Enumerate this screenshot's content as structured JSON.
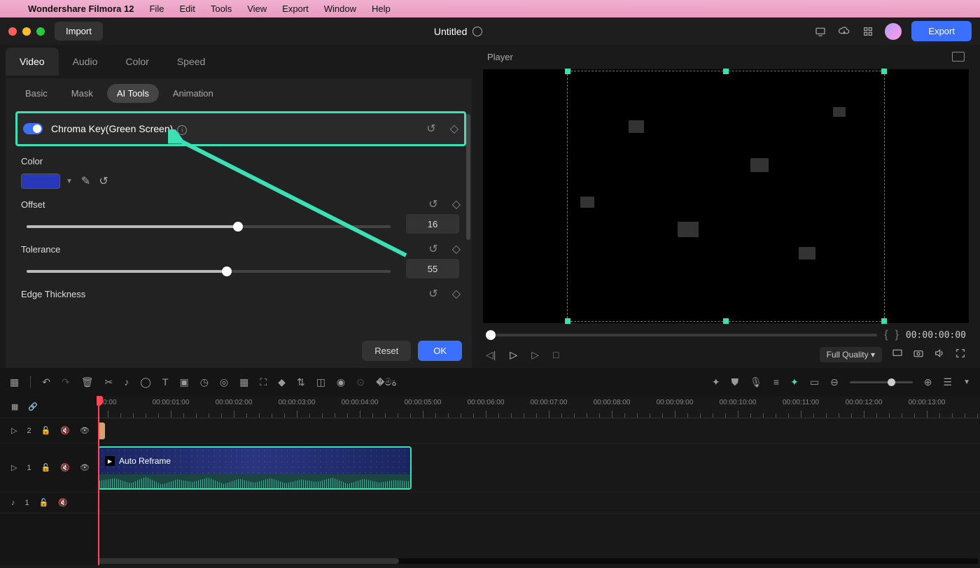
{
  "menubar": {
    "app": "Wondershare Filmora 12",
    "items": [
      "File",
      "Edit",
      "Tools",
      "View",
      "Export",
      "Window",
      "Help"
    ]
  },
  "titlebar": {
    "import": "Import",
    "title": "Untitled",
    "export": "Export"
  },
  "left": {
    "topTabs": [
      "Video",
      "Audio",
      "Color",
      "Speed"
    ],
    "subTabs": [
      "Basic",
      "Mask",
      "AI Tools",
      "Animation"
    ],
    "chroma": {
      "label": "Chroma Key(Green Screen)"
    },
    "color": {
      "label": "Color"
    },
    "offset": {
      "label": "Offset",
      "value": "16",
      "pct": 58
    },
    "tolerance": {
      "label": "Tolerance",
      "value": "55",
      "pct": 55
    },
    "edge": {
      "label": "Edge Thickness"
    },
    "reset": "Reset",
    "ok": "OK"
  },
  "player": {
    "label": "Player",
    "timecode": "00:00:00:00",
    "quality": "Full Quality"
  },
  "timeline": {
    "ticks": [
      "00:00",
      "00:00:01:00",
      "00:00:02:00",
      "00:00:03:00",
      "00:00:04:00",
      "00:00:05:00",
      "00:00:06:00",
      "00:00:07:00",
      "00:00:08:00",
      "00:00:09:00",
      "00:00:10:00",
      "00:00:11:00",
      "00:00:12:00",
      "00:00:13:00",
      "00:00"
    ],
    "track2": "2",
    "track1": "1",
    "trackA": "1",
    "clipLabel": "Auto Reframe"
  }
}
